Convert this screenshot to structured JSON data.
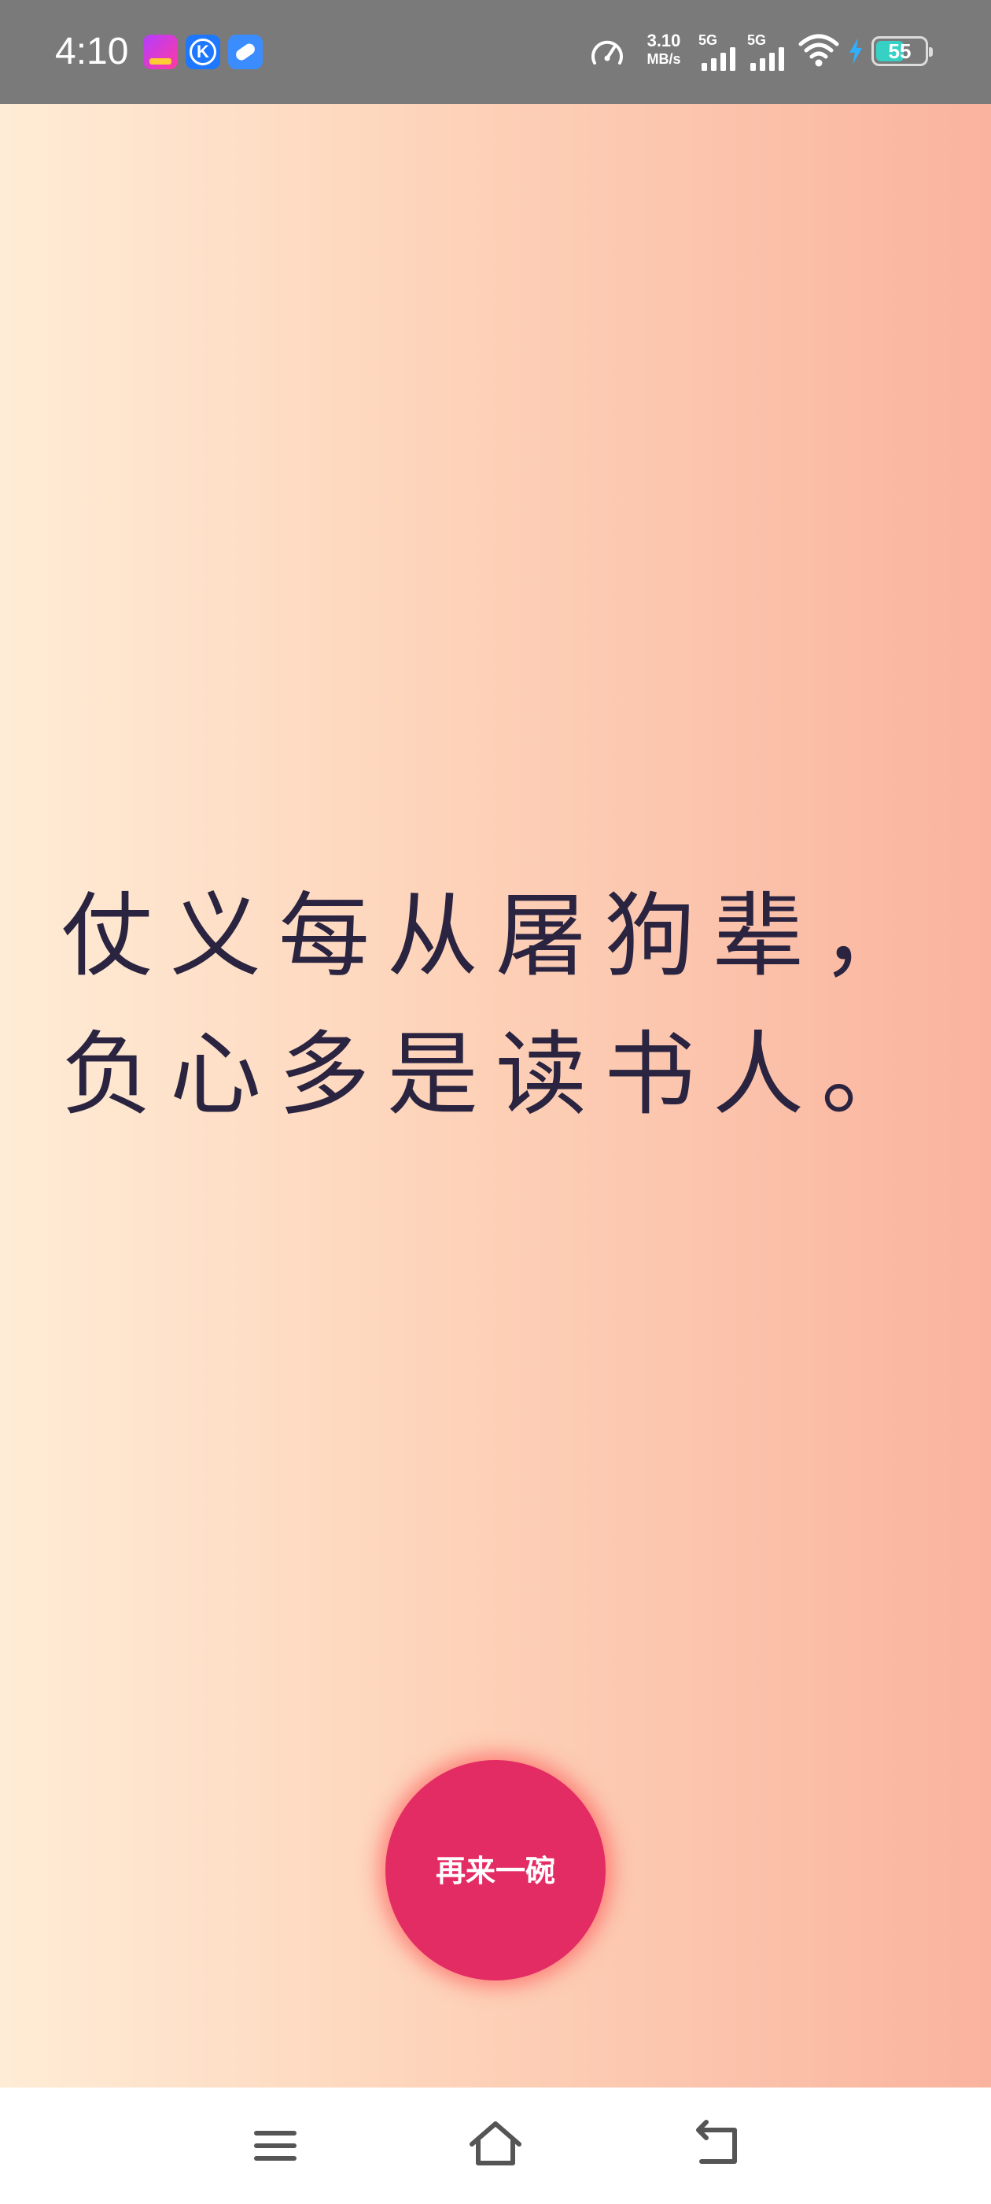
{
  "status_bar": {
    "time": "4:10",
    "apps": [
      "game-app-icon",
      "k-app-icon",
      "message-app-icon"
    ],
    "net_speed_value": "3.10",
    "net_speed_unit": "MB/s",
    "sim1_label": "5G",
    "sim2_label": "5G",
    "battery_level": "55",
    "icons": [
      "speedometer-icon",
      "signal-icon",
      "wifi-icon",
      "charging-bolt-icon",
      "battery-icon"
    ]
  },
  "main": {
    "quote": "仗义每从屠狗辈，负心多是读书人。",
    "again_button_label": "再来一碗",
    "colors": {
      "gradient_left": "#ffecd6",
      "gradient_right": "#fab39e",
      "quote_text": "#2a2440",
      "button": "#e32b64"
    }
  },
  "nav_bar": {
    "icons": [
      "menu-icon",
      "home-icon",
      "back-icon"
    ]
  }
}
